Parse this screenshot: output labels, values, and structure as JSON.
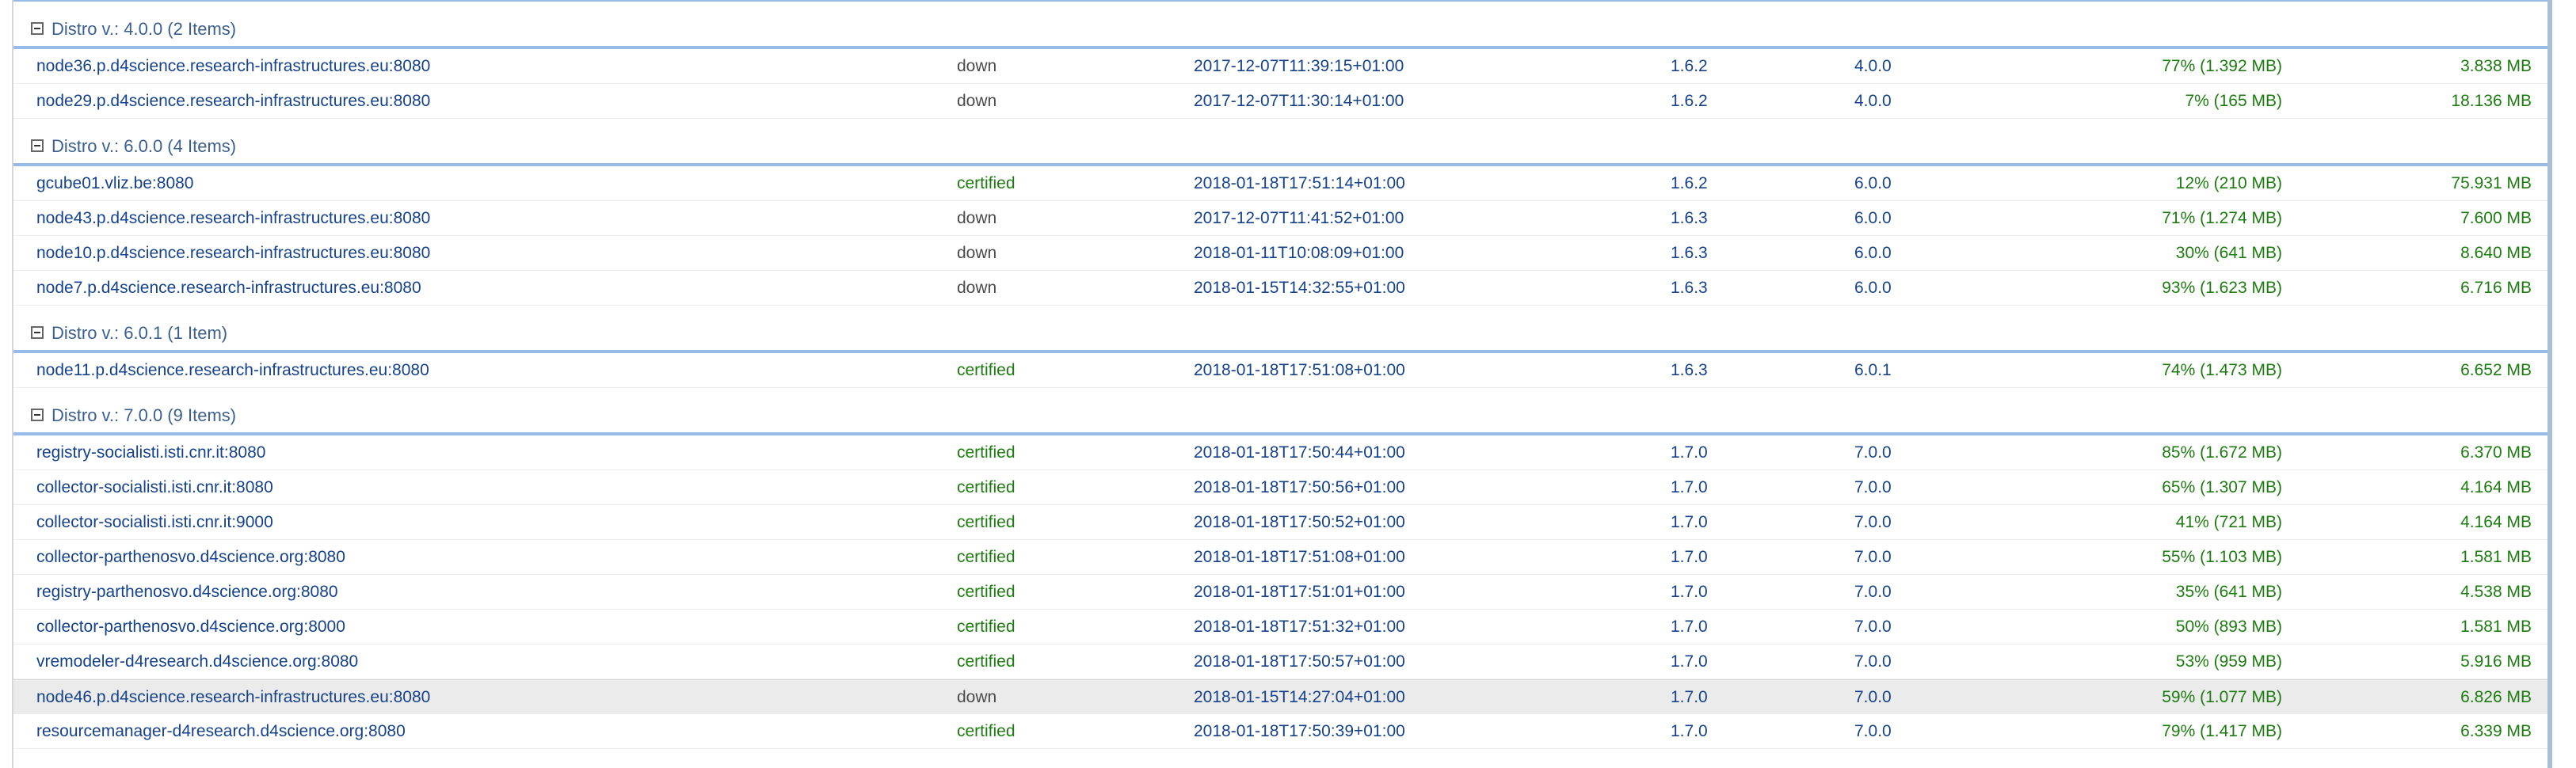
{
  "groups": [
    {
      "title": "Distro v.: 4.0.0 (2 Items)",
      "rows": [
        {
          "host": "node36.p.d4science.research-infrastructures.eu:8080",
          "state": "down",
          "date": "2017-12-07T11:39:15+01:00",
          "version": "1.6.2",
          "distro": "4.0.0",
          "memory": "77% (1.392 MB)",
          "disk": "3.838 MB"
        },
        {
          "host": "node29.p.d4science.research-infrastructures.eu:8080",
          "state": "down",
          "date": "2017-12-07T11:30:14+01:00",
          "version": "1.6.2",
          "distro": "4.0.0",
          "memory": "7% (165 MB)",
          "disk": "18.136 MB"
        }
      ]
    },
    {
      "title": "Distro v.: 6.0.0 (4 Items)",
      "rows": [
        {
          "host": "gcube01.vliz.be:8080",
          "state": "certified",
          "date": "2018-01-18T17:51:14+01:00",
          "version": "1.6.2",
          "distro": "6.0.0",
          "memory": "12% (210 MB)",
          "disk": "75.931 MB"
        },
        {
          "host": "node43.p.d4science.research-infrastructures.eu:8080",
          "state": "down",
          "date": "2017-12-07T11:41:52+01:00",
          "version": "1.6.3",
          "distro": "6.0.0",
          "memory": "71% (1.274 MB)",
          "disk": "7.600 MB"
        },
        {
          "host": "node10.p.d4science.research-infrastructures.eu:8080",
          "state": "down",
          "date": "2018-01-11T10:08:09+01:00",
          "version": "1.6.3",
          "distro": "6.0.0",
          "memory": "30% (641 MB)",
          "disk": "8.640 MB"
        },
        {
          "host": "node7.p.d4science.research-infrastructures.eu:8080",
          "state": "down",
          "date": "2018-01-15T14:32:55+01:00",
          "version": "1.6.3",
          "distro": "6.0.0",
          "memory": "93% (1.623 MB)",
          "disk": "6.716 MB"
        }
      ]
    },
    {
      "title": "Distro v.: 6.0.1 (1 Item)",
      "rows": [
        {
          "host": "node11.p.d4science.research-infrastructures.eu:8080",
          "state": "certified",
          "date": "2018-01-18T17:51:08+01:00",
          "version": "1.6.3",
          "distro": "6.0.1",
          "memory": "74% (1.473 MB)",
          "disk": "6.652 MB"
        }
      ]
    },
    {
      "title": "Distro v.: 7.0.0 (9 Items)",
      "rows": [
        {
          "host": "registry-socialisti.isti.cnr.it:8080",
          "state": "certified",
          "date": "2018-01-18T17:50:44+01:00",
          "version": "1.7.0",
          "distro": "7.0.0",
          "memory": "85% (1.672 MB)",
          "disk": "6.370 MB"
        },
        {
          "host": "collector-socialisti.isti.cnr.it:8080",
          "state": "certified",
          "date": "2018-01-18T17:50:56+01:00",
          "version": "1.7.0",
          "distro": "7.0.0",
          "memory": "65% (1.307 MB)",
          "disk": "4.164 MB"
        },
        {
          "host": "collector-socialisti.isti.cnr.it:9000",
          "state": "certified",
          "date": "2018-01-18T17:50:52+01:00",
          "version": "1.7.0",
          "distro": "7.0.0",
          "memory": "41% (721 MB)",
          "disk": "4.164 MB"
        },
        {
          "host": "collector-parthenosvo.d4science.org:8080",
          "state": "certified",
          "date": "2018-01-18T17:51:08+01:00",
          "version": "1.7.0",
          "distro": "7.0.0",
          "memory": "55% (1.103 MB)",
          "disk": "1.581 MB"
        },
        {
          "host": "registry-parthenosvo.d4science.org:8080",
          "state": "certified",
          "date": "2018-01-18T17:51:01+01:00",
          "version": "1.7.0",
          "distro": "7.0.0",
          "memory": "35% (641 MB)",
          "disk": "4.538 MB"
        },
        {
          "host": "collector-parthenosvo.d4science.org:8000",
          "state": "certified",
          "date": "2018-01-18T17:51:32+01:00",
          "version": "1.7.0",
          "distro": "7.0.0",
          "memory": "50% (893 MB)",
          "disk": "1.581 MB"
        },
        {
          "host": "vremodeler-d4research.d4science.org:8080",
          "state": "certified",
          "date": "2018-01-18T17:50:57+01:00",
          "version": "1.7.0",
          "distro": "7.0.0",
          "memory": "53% (959 MB)",
          "disk": "5.916 MB"
        },
        {
          "host": "node46.p.d4science.research-infrastructures.eu:8080",
          "state": "down",
          "date": "2018-01-15T14:27:04+01:00",
          "version": "1.7.0",
          "distro": "7.0.0",
          "memory": "59% (1.077 MB)",
          "disk": "6.826 MB",
          "selected": true
        },
        {
          "host": "resourcemanager-d4research.d4science.org:8080",
          "state": "certified",
          "date": "2018-01-18T17:50:39+01:00",
          "version": "1.7.0",
          "distro": "7.0.0",
          "memory": "79% (1.417 MB)",
          "disk": "6.339 MB"
        }
      ]
    }
  ],
  "colors": {
    "group_border": "#99bbe8",
    "link_text": "#15428b",
    "certified": "#1d7c10",
    "down": "#4b4b4b"
  },
  "icons": {
    "group_toggle": "collapse-minus-icon"
  }
}
